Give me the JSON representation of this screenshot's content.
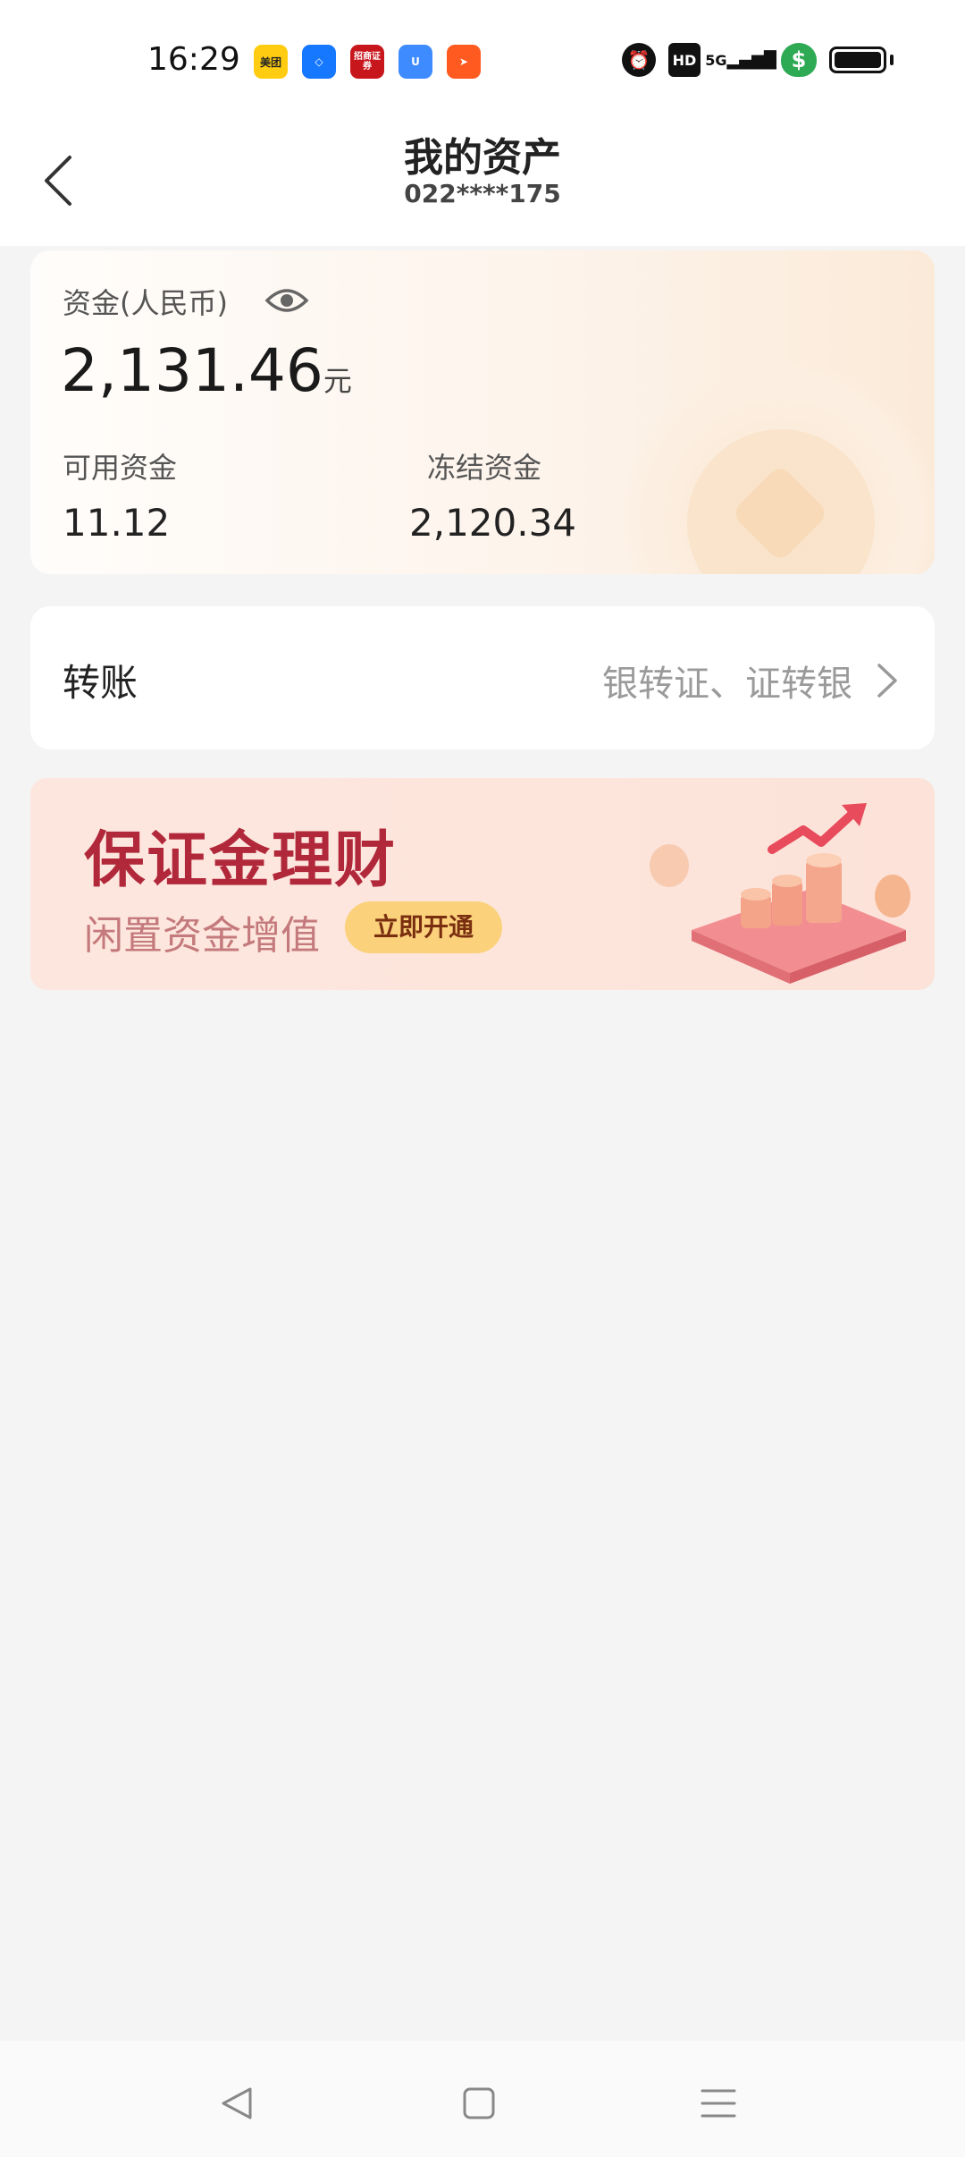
{
  "status_bar": {
    "time": "16:29",
    "app_icons": [
      "美团",
      "",
      "招商证券",
      "",
      ""
    ],
    "indicators": {
      "hd": "HD",
      "network": "5G"
    }
  },
  "header": {
    "title": "我的资产",
    "account": "022****175"
  },
  "asset_card": {
    "fund_label": "资金(人民币)",
    "fund_amount": "2,131.46",
    "fund_unit": "元",
    "available_label": "可用资金",
    "available_value": "11.12",
    "frozen_label": "冻结资金",
    "frozen_value": "2,120.34"
  },
  "transfer": {
    "label": "转账",
    "sub_label": "银转证、证转银"
  },
  "banner": {
    "title": "保证金理财",
    "subtitle": "闲置资金增值",
    "button_label": "立即开通",
    "colors": {
      "title": "#b1283b",
      "button": "#fbd27b"
    }
  }
}
